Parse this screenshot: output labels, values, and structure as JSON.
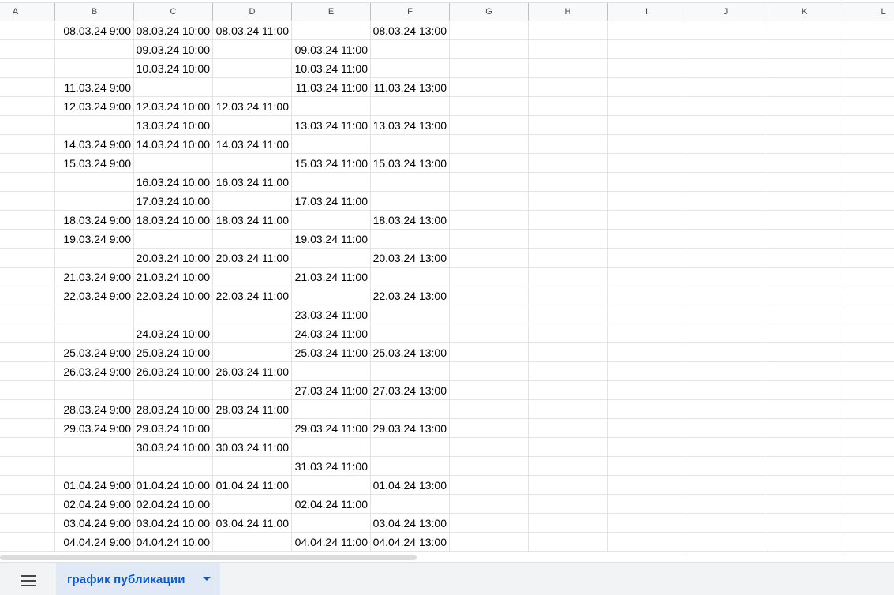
{
  "columns": [
    "A",
    "B",
    "C",
    "D",
    "E",
    "F",
    "G",
    "H",
    "I",
    "J",
    "K",
    "L"
  ],
  "rows": [
    [
      "",
      "08.03.24 9:00",
      "08.03.24 10:00",
      "08.03.24 11:00",
      "",
      "08.03.24 13:00"
    ],
    [
      "",
      "",
      "09.03.24 10:00",
      "",
      "09.03.24 11:00",
      ""
    ],
    [
      "",
      "",
      "10.03.24 10:00",
      "",
      "10.03.24 11:00",
      ""
    ],
    [
      "",
      "11.03.24 9:00",
      "",
      "",
      "11.03.24 11:00",
      "11.03.24 13:00"
    ],
    [
      "",
      "12.03.24 9:00",
      "12.03.24 10:00",
      "12.03.24 11:00",
      "",
      ""
    ],
    [
      "",
      "",
      "13.03.24 10:00",
      "",
      "13.03.24 11:00",
      "13.03.24 13:00"
    ],
    [
      "",
      "14.03.24 9:00",
      "14.03.24 10:00",
      "14.03.24 11:00",
      "",
      ""
    ],
    [
      "",
      "15.03.24 9:00",
      "",
      "",
      "15.03.24 11:00",
      "15.03.24 13:00"
    ],
    [
      "",
      "",
      "16.03.24 10:00",
      "16.03.24 11:00",
      "",
      ""
    ],
    [
      "",
      "",
      "17.03.24 10:00",
      "",
      "17.03.24 11:00",
      ""
    ],
    [
      "",
      "18.03.24 9:00",
      "18.03.24 10:00",
      "18.03.24 11:00",
      "",
      "18.03.24 13:00"
    ],
    [
      "",
      "19.03.24 9:00",
      "",
      "",
      "19.03.24 11:00",
      ""
    ],
    [
      "",
      "",
      "20.03.24 10:00",
      "20.03.24 11:00",
      "",
      "20.03.24 13:00"
    ],
    [
      "",
      "21.03.24 9:00",
      "21.03.24 10:00",
      "",
      "21.03.24 11:00",
      ""
    ],
    [
      "",
      "22.03.24 9:00",
      "22.03.24 10:00",
      "22.03.24 11:00",
      "",
      "22.03.24 13:00"
    ],
    [
      "",
      "",
      "",
      "",
      "23.03.24 11:00",
      ""
    ],
    [
      "",
      "",
      "24.03.24 10:00",
      "",
      "24.03.24 11:00",
      ""
    ],
    [
      "",
      "25.03.24 9:00",
      "25.03.24 10:00",
      "",
      "25.03.24 11:00",
      "25.03.24 13:00"
    ],
    [
      "",
      "26.03.24 9:00",
      "26.03.24 10:00",
      "26.03.24 11:00",
      "",
      ""
    ],
    [
      "",
      "",
      "",
      "",
      "27.03.24 11:00",
      "27.03.24 13:00"
    ],
    [
      "",
      "28.03.24 9:00",
      "28.03.24 10:00",
      "28.03.24 11:00",
      "",
      ""
    ],
    [
      "",
      "29.03.24 9:00",
      "29.03.24 10:00",
      "",
      "29.03.24 11:00",
      "29.03.24 13:00"
    ],
    [
      "",
      "",
      "30.03.24 10:00",
      "30.03.24 11:00",
      "",
      ""
    ],
    [
      "",
      "",
      "",
      "",
      "31.03.24 11:00",
      ""
    ],
    [
      "",
      "01.04.24 9:00",
      "01.04.24 10:00",
      "01.04.24 11:00",
      "",
      "01.04.24 13:00"
    ],
    [
      "",
      "02.04.24 9:00",
      "02.04.24 10:00",
      "",
      "02.04.24 11:00",
      ""
    ],
    [
      "",
      "03.04.24 9:00",
      "03.04.24 10:00",
      "03.04.24 11:00",
      "",
      "03.04.24 13:00"
    ],
    [
      "",
      "04.04.24 9:00",
      "04.04.24 10:00",
      "",
      "04.04.24 11:00",
      "04.04.24 13:00"
    ]
  ],
  "sheet_bar": {
    "menu_icon": "hamburger-menu-icon",
    "tab_label": "график публикации",
    "tab_caret_icon": "caret-down-icon",
    "accent_color": "#0b57d0"
  }
}
